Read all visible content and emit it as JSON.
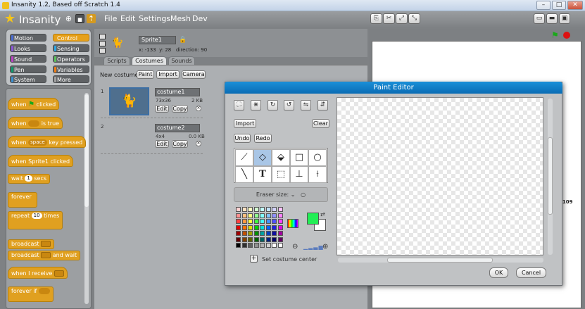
{
  "window": {
    "title": "Insanity 1.2, Based off Scratch 1.4"
  },
  "app": {
    "logo_text": "Insanity"
  },
  "menu": [
    "File",
    "Edit",
    "Settings",
    "Mesh",
    "Dev"
  ],
  "categories": [
    {
      "label": "Motion",
      "color": "#4a6cd4"
    },
    {
      "label": "Control",
      "color": "#e6a01a",
      "selected": true
    },
    {
      "label": "Looks",
      "color": "#8a55d7"
    },
    {
      "label": "Sensing",
      "color": "#2ca5e2"
    },
    {
      "label": "Sound",
      "color": "#bb42c3"
    },
    {
      "label": "Operators",
      "color": "#59c059"
    },
    {
      "label": "Pen",
      "color": "#0e9a6c"
    },
    {
      "label": "Variables",
      "color": "#ee7d16"
    },
    {
      "label": "System",
      "color": "#3a8fd0"
    },
    {
      "label": "More",
      "color": "#a0a0a0"
    }
  ],
  "blocks": {
    "when_flag": {
      "pre": "when",
      "post": "clicked"
    },
    "when_true": {
      "pre": "when",
      "post": "is true"
    },
    "when_key": {
      "pre": "when",
      "key": "space",
      "post": "key pressed"
    },
    "when_sprite": {
      "label": "when Sprite1 clicked"
    },
    "wait": {
      "pre": "wait",
      "value": "1",
      "post": "secs"
    },
    "forever": {
      "label": "forever"
    },
    "repeat": {
      "pre": "repeat",
      "value": "10",
      "post": "times"
    },
    "broadcast": {
      "label": "broadcast"
    },
    "broadcast_wait": {
      "pre": "broadcast",
      "post": "and wait"
    },
    "when_receive": {
      "label": "when I receive"
    },
    "forever_if": {
      "label": "forever if"
    }
  },
  "sprite": {
    "name": "Sprite1",
    "x_label": "x:",
    "x": "-133",
    "y_label": "y:",
    "y": "28",
    "direction_label": "direction:",
    "direction": "90"
  },
  "tabs": {
    "scripts": "Scripts",
    "costumes": "Costumes",
    "sounds": "Sounds"
  },
  "costumes_header": {
    "new_costume": "New costume:",
    "paint": "Paint",
    "import": "Import",
    "camera": "Camera"
  },
  "costumes": [
    {
      "index": "1",
      "name": "costume1",
      "dims": "73x36",
      "size": "2 KB",
      "edit": "Edit",
      "copy": "Copy"
    },
    {
      "index": "2",
      "name": "costume2",
      "dims": "4x4",
      "size": "0.0 KB",
      "edit": "Edit",
      "copy": "Copy"
    }
  ],
  "stage": {
    "readout": "-109"
  },
  "paint_editor": {
    "title": "Paint Editor",
    "import": "Import",
    "clear": "Clear",
    "undo": "Undo",
    "redo": "Redo",
    "eraser_size": "Eraser size:",
    "set_center": "Set costume center",
    "ok": "OK",
    "cancel": "Cancel",
    "fg_color": "#22ee55",
    "bg_color": "#ffffff"
  },
  "palette_colors": [
    "#ffd0d0",
    "#ffe0c0",
    "#ffffc0",
    "#d0ffd0",
    "#c0ffff",
    "#c0e0ff",
    "#d0d0ff",
    "#ffc0ff",
    "#ff9090",
    "#ffc080",
    "#ffff80",
    "#90ff90",
    "#80ffff",
    "#80c0ff",
    "#9090ff",
    "#ff80ff",
    "#ff4040",
    "#ff9940",
    "#ffff40",
    "#40ff40",
    "#40ffff",
    "#4090ff",
    "#5050ff",
    "#ff40ff",
    "#e00000",
    "#ff7000",
    "#e0e000",
    "#00d000",
    "#00e0e0",
    "#0060ff",
    "#2020e0",
    "#e000e0",
    "#a00000",
    "#c05000",
    "#a0a000",
    "#009000",
    "#00a0a0",
    "#0040c0",
    "#1010a0",
    "#a000a0",
    "#600000",
    "#804000",
    "#606000",
    "#006000",
    "#006060",
    "#002080",
    "#000060",
    "#600060",
    "#000000",
    "#303030",
    "#606060",
    "#909090",
    "#b0b0b0",
    "#d0d0d0",
    "#ffffff",
    "#ffffff"
  ]
}
